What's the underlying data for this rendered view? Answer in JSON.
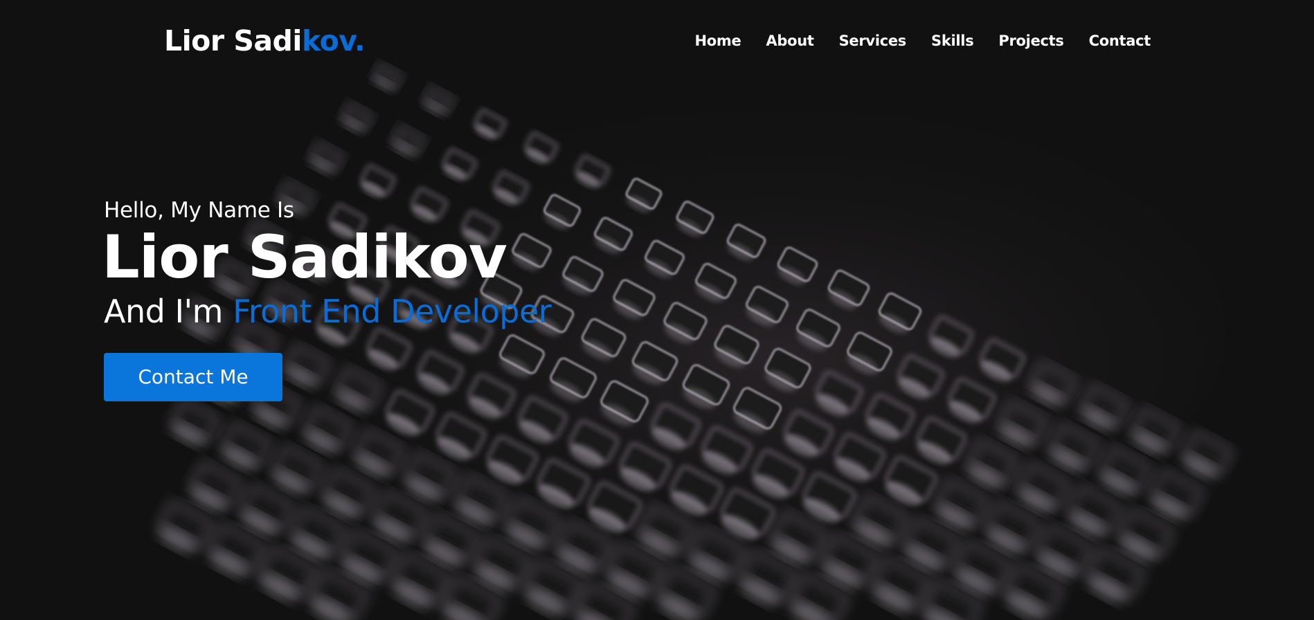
{
  "navbar": {
    "logo_main": "Lior Sadi",
    "logo_accent": "kov.",
    "links": [
      {
        "label": "Home"
      },
      {
        "label": "About"
      },
      {
        "label": "Services"
      },
      {
        "label": "Skills"
      },
      {
        "label": "Projects"
      },
      {
        "label": "Contact"
      }
    ]
  },
  "hero": {
    "greeting": "Hello, My Name Is",
    "name": "Lior Sadikov",
    "role_prefix": "And I'm ",
    "role_accent": "Front End Developer",
    "cta_label": "Contact Me",
    "background_image": "backlit-keyboard-photo"
  },
  "colors": {
    "background": "#111111",
    "accent": "#0a6cd6",
    "button": "#0a76db",
    "text": "#ffffff"
  }
}
